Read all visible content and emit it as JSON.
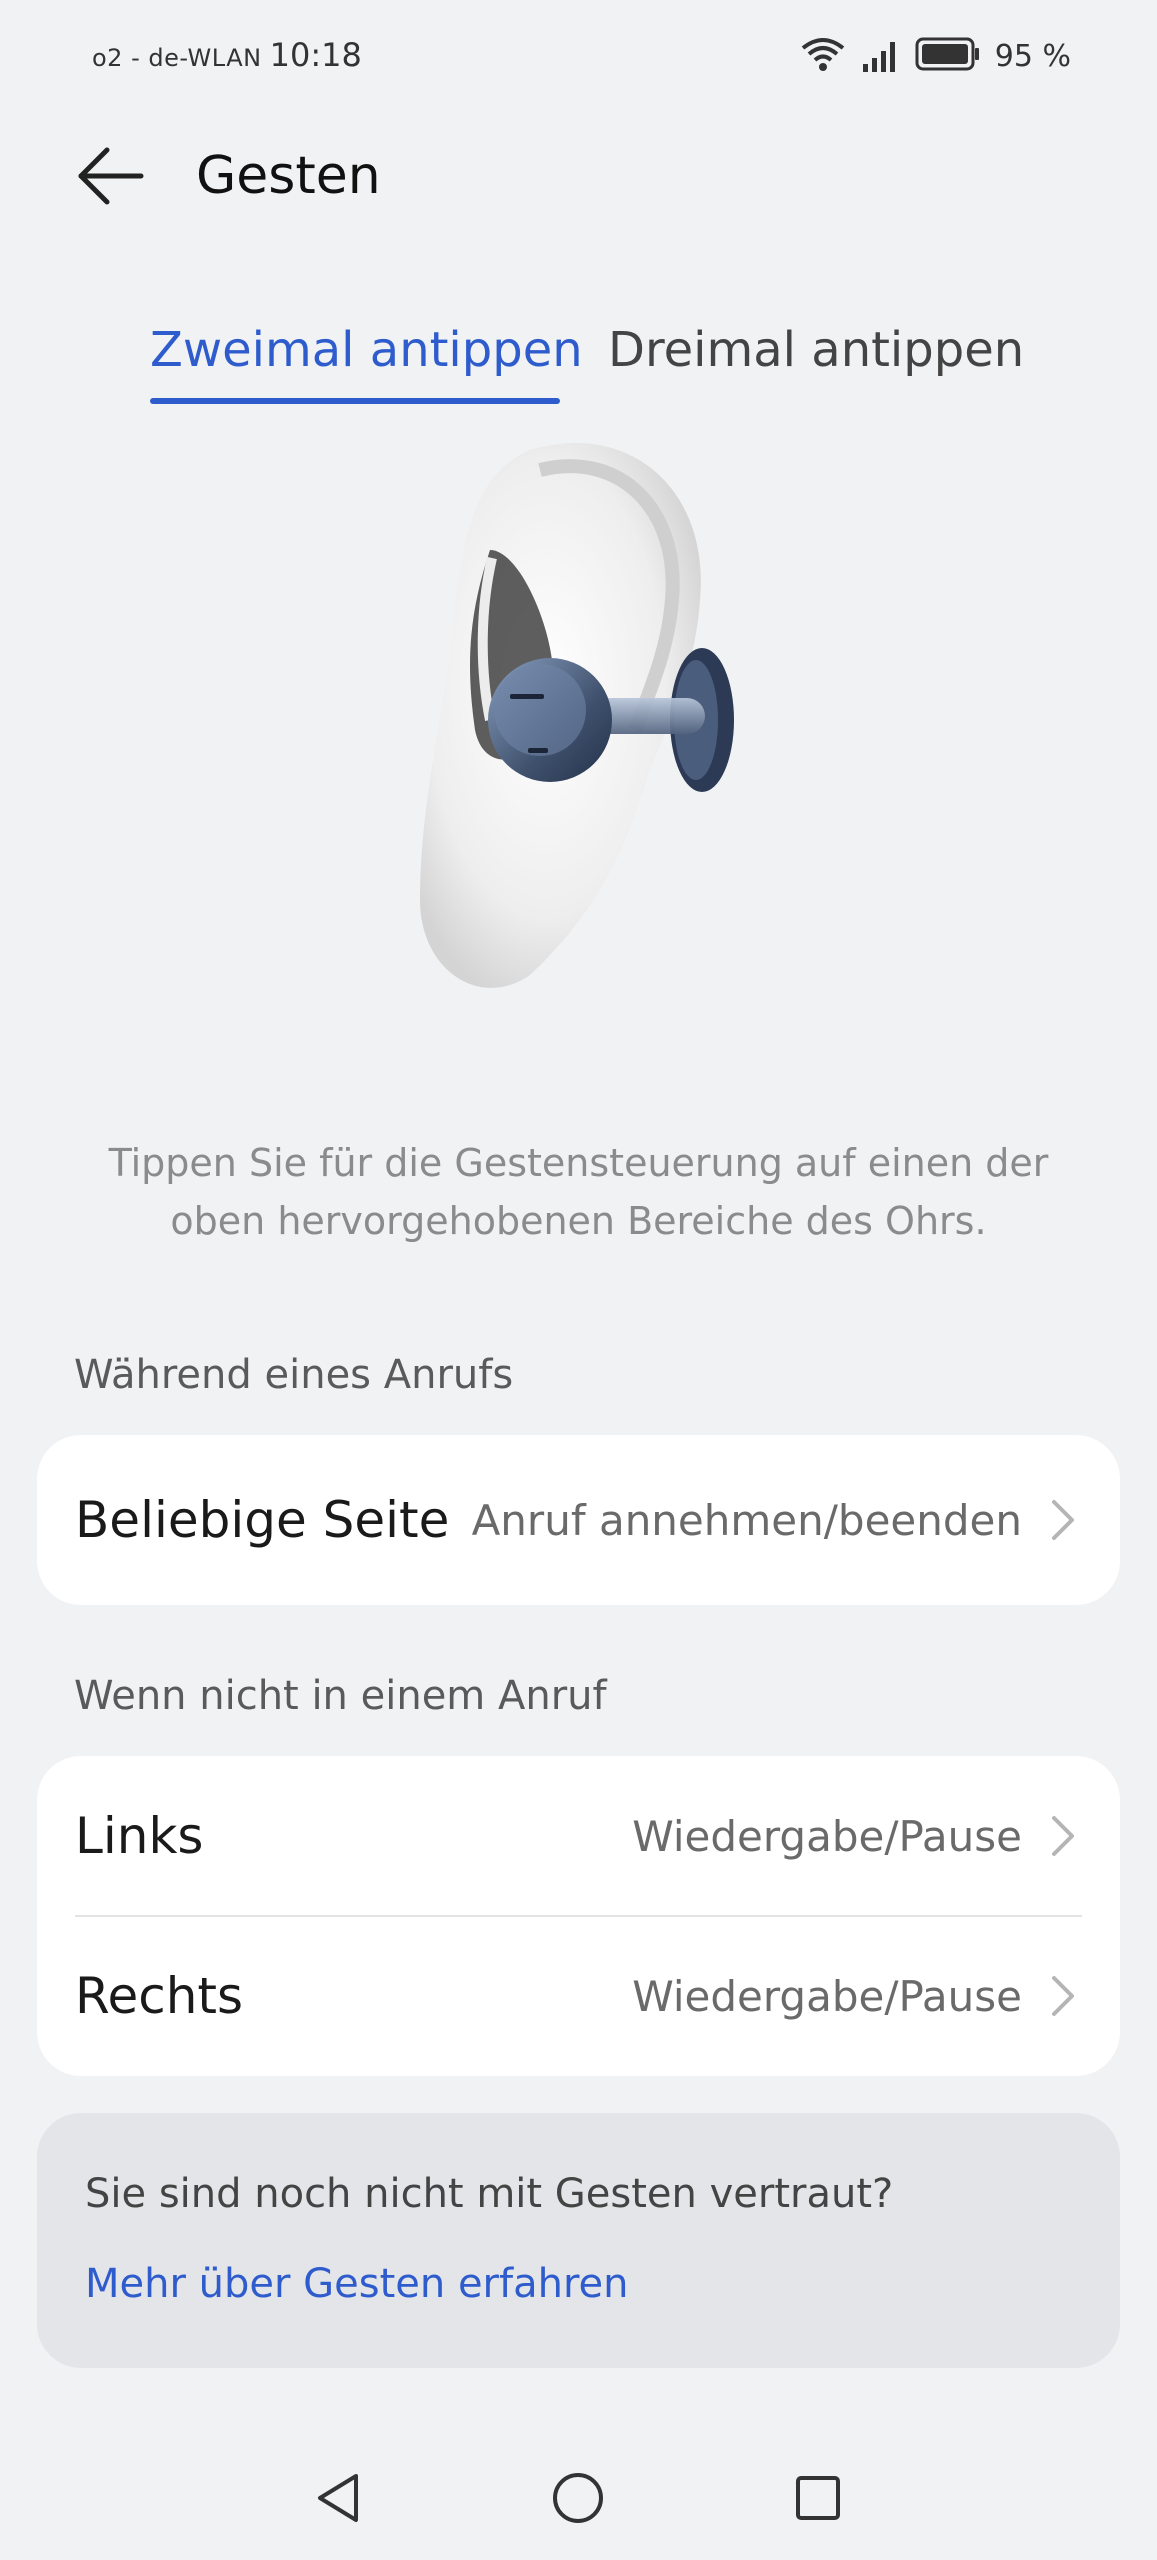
{
  "status_bar": {
    "carrier": "o2 - de-WLAN",
    "time": "10:18",
    "battery_percent": "95 %",
    "icons": [
      "wifi-icon",
      "signal-icon",
      "battery-icon"
    ]
  },
  "header": {
    "title": "Gesten",
    "back_icon": "back-arrow-icon"
  },
  "tabs": [
    {
      "label": "Zweimal antippen",
      "active": true
    },
    {
      "label": "Dreimal antippen",
      "active": false
    }
  ],
  "hint": "Tippen Sie für die Gestensteuerung auf einen der oben hervorgehobenen Bereiche des Ohrs.",
  "during_call": {
    "label": "Während eines Anrufs",
    "rows": [
      {
        "label": "Beliebige Seite",
        "value": "Anruf annehmen/beenden"
      }
    ]
  },
  "not_in_call": {
    "label": "Wenn nicht in einem Anruf",
    "rows": [
      {
        "label": "Links",
        "value": "Wiedergabe/Pause"
      },
      {
        "label": "Rechts",
        "value": "Wiedergabe/Pause"
      }
    ]
  },
  "info": {
    "question": "Sie sind noch nicht mit Gesten vertraut?",
    "link": "Mehr über Gesten erfahren"
  },
  "colors": {
    "accent": "#2e5ccd",
    "background": "#f1f2f4"
  },
  "nav_bar": [
    "back-triangle-icon",
    "home-circle-icon",
    "recents-square-icon"
  ]
}
